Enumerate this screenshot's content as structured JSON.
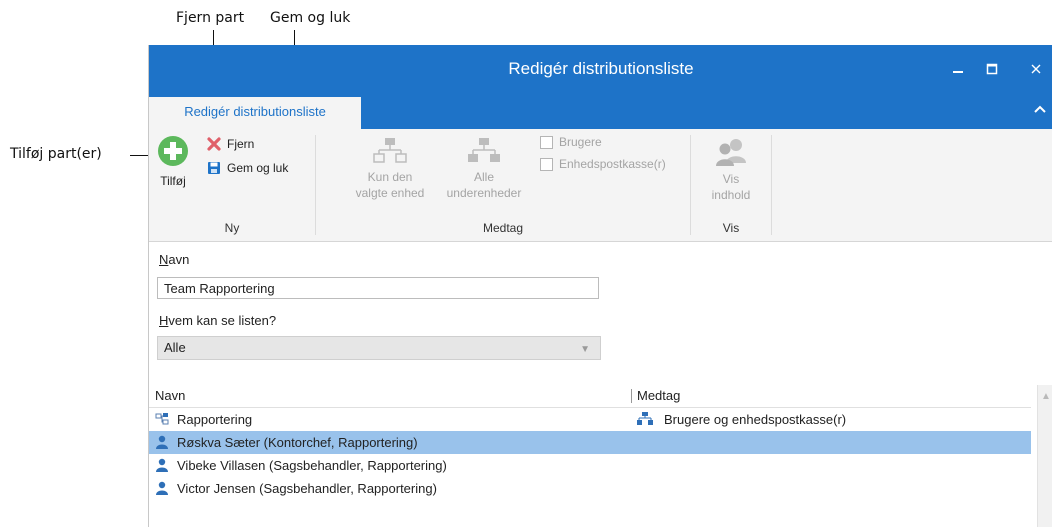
{
  "callouts": {
    "remove_party": "Fjern part",
    "save_close": "Gem og luk",
    "add_parties": "Tilføj part(er)"
  },
  "window": {
    "title": "Redigér distributionsliste",
    "minimize_icon": "minimize-icon",
    "maximize_icon": "maximize-icon",
    "close_icon": "close-icon"
  },
  "ribbon": {
    "tab_label": "Redigér distributionsliste",
    "groups": {
      "new": {
        "label": "Ny",
        "add_label": "Tilføj",
        "remove_label": "Fjern",
        "save_close_label": "Gem og luk"
      },
      "include": {
        "label": "Medtag",
        "selected_unit_line1": "Kun den",
        "selected_unit_line2": "valgte enhed",
        "all_subunits_line1": "Alle",
        "all_subunits_line2": "underenheder",
        "users_label": "Brugere",
        "unit_mailbox_label": "Enhedspostkasse(r)"
      },
      "view": {
        "label": "Vis",
        "show_content_line1": "Vis",
        "show_content_line2": "indhold"
      }
    }
  },
  "form": {
    "name_label_first": "N",
    "name_label_rest": "avn",
    "name_value": "Team Rapportering",
    "visibility_label_first": "H",
    "visibility_label_rest": "vem kan se listen?",
    "visibility_value": "Alle"
  },
  "grid": {
    "columns": [
      "Navn",
      "Medtag"
    ],
    "rows": [
      {
        "name": "Rapportering",
        "include": "Brugere og enhedspostkasse(r)",
        "icon": "org-unit-icon",
        "selected": false
      },
      {
        "name": "Røskva Sæter (Kontorchef, Rapportering)",
        "include": "",
        "icon": "user-icon",
        "selected": true
      },
      {
        "name": "Vibeke Villasen (Sagsbehandler, Rapportering)",
        "include": "",
        "icon": "user-icon",
        "selected": false
      },
      {
        "name": "Victor Jensen (Sagsbehandler, Rapportering)",
        "include": "",
        "icon": "user-icon",
        "selected": false
      }
    ]
  },
  "colors": {
    "titlebar": "#1e73c8",
    "selected_row": "#99c2eb",
    "add_icon": "#5cb85c",
    "remove_icon": "#e0606a",
    "save_icon": "#1e73c8",
    "user_icon": "#2e6fb7"
  }
}
